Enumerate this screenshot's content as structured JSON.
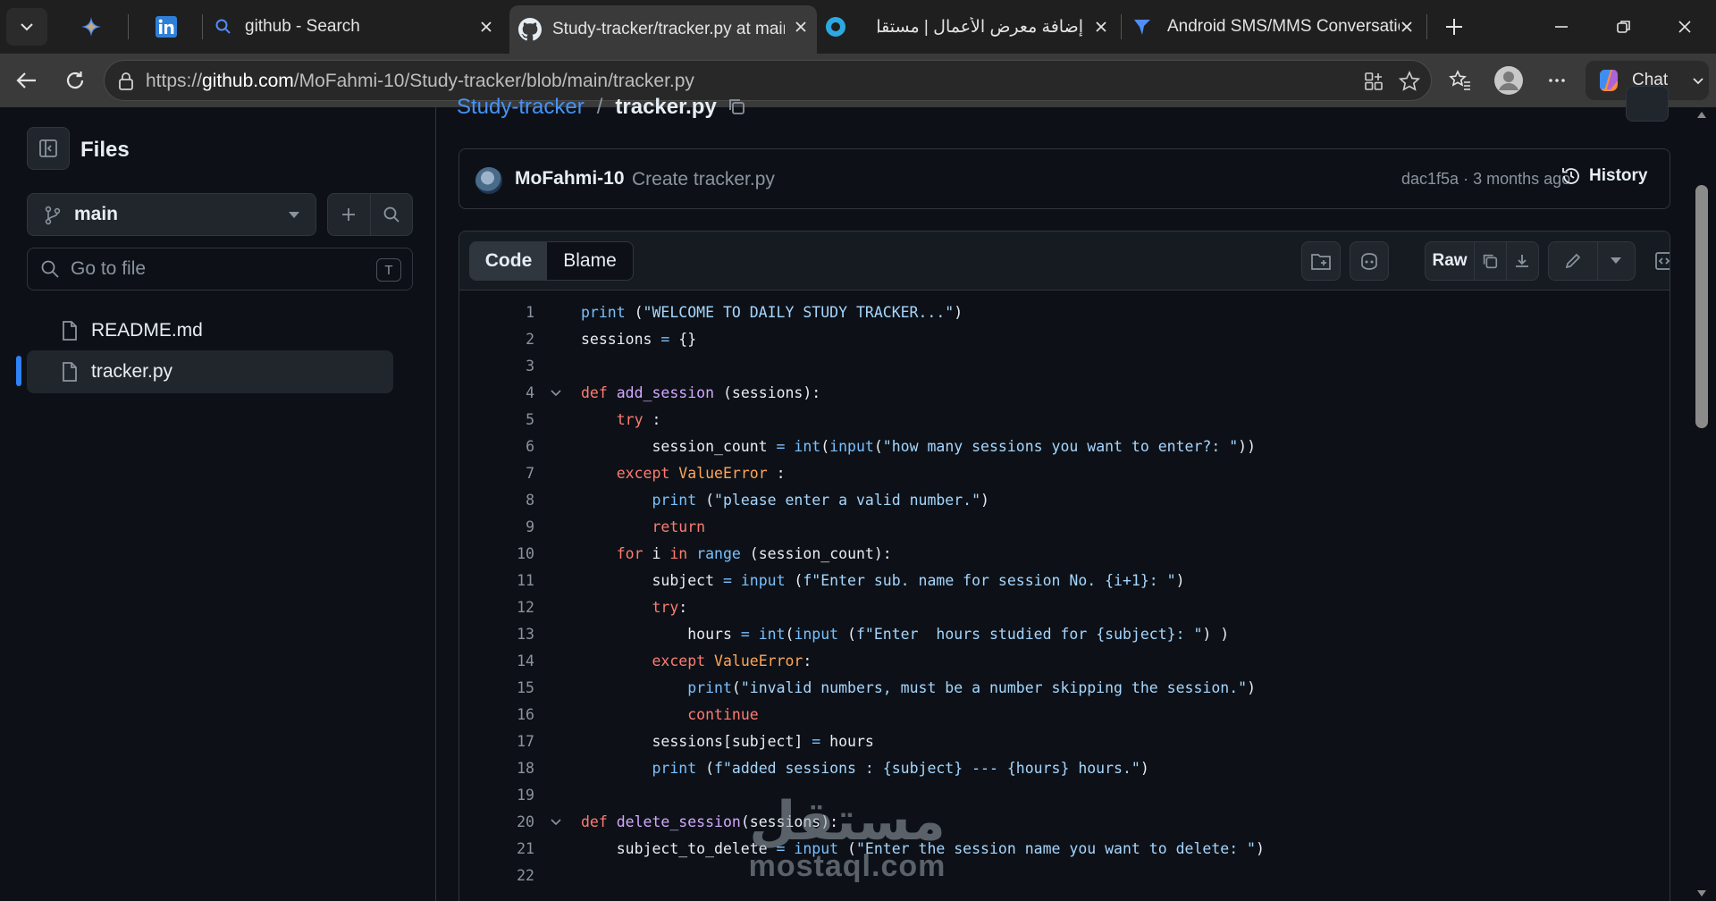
{
  "browser": {
    "tabs": [
      {
        "title": "",
        "icon": "copilot-sparkle-icon"
      },
      {
        "title": "",
        "icon": "linkedin-icon"
      },
      {
        "title": "github - Search",
        "icon": "search-icon"
      },
      {
        "title": "Study-tracker/tracker.py at main",
        "icon": "github-icon",
        "active": true
      },
      {
        "title": "إضافة معرض الأعمال | مستقل",
        "icon": "mostaql-icon"
      },
      {
        "title": "Android SMS/MMS Conversatio",
        "icon": "bird-icon"
      }
    ],
    "url_prefix": "https://",
    "url_host": "github.com",
    "url_path": "/MoFahmi-10/Study-tracker/blob/main/tracker.py",
    "chat_label": "Chat"
  },
  "sidebar": {
    "title": "Files",
    "branch": "main",
    "goto_placeholder": "Go to file",
    "goto_shortcut": "T",
    "files": [
      {
        "name": "README.md",
        "selected": false
      },
      {
        "name": "tracker.py",
        "selected": true
      }
    ]
  },
  "breadcrumb": {
    "repo": "Study-tracker",
    "separator": "/",
    "file": "tracker.py"
  },
  "commit": {
    "author": "MoFahmi-10",
    "message": "Create tracker.py",
    "sha": "dac1f5a",
    "age": "3 months ago",
    "history_label": "History"
  },
  "code_header": {
    "tab_code": "Code",
    "tab_blame": "Blame",
    "raw_label": "Raw"
  },
  "code_lines": [
    "1",
    "2",
    "3",
    "4",
    "5",
    "6",
    "7",
    "8",
    "9",
    "10",
    "11",
    "12",
    "13",
    "14",
    "15",
    "16",
    "17",
    "18",
    "19",
    "20",
    "21",
    "22"
  ],
  "code_text": [
    "print (\"WELCOME TO DAILY STUDY TRACKER...\")",
    "sessions = {}",
    "",
    "def add_session (sessions):",
    "    try :",
    "        session_count = int(input(\"how many sessions you want to enter?: \"))",
    "    except ValueError :",
    "        print (\"please enter a valid number.\")",
    "        return",
    "    for i in range (session_count):",
    "        subject = input (f\"Enter sub. name for session No. {i+1}: \")",
    "        try:",
    "            hours = int(input (f\"Enter  hours studied for {subject}: \") )",
    "        except ValueError:",
    "            print(\"invalid numbers, must be a number skipping the session.\")",
    "            continue",
    "        sessions[subject] = hours",
    "        print (f\"added sessions : {subject} --- {hours} hours.\")",
    "",
    "def delete_session(sessions):",
    "    subject_to_delete = input (\"Enter the session name you want to delete: \")",
    ""
  ],
  "watermark": {
    "arabic": "مستقل",
    "latin": "mostaql.com"
  },
  "colors": {
    "accent": "#4493f8",
    "keyword": "#ff7b72",
    "function": "#d2a8ff",
    "string": "#a5d6ff",
    "builtin": "#79c0ff",
    "exception": "#ffa657"
  }
}
